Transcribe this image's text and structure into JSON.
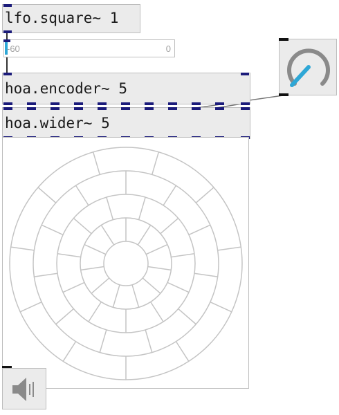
{
  "objects": {
    "lfo": {
      "text": "lfo.square~ 1"
    },
    "encoder": {
      "text": "hoa.encoder~ 5"
    },
    "wider": {
      "text": "hoa.wider~ 5"
    }
  },
  "number_box": {
    "min_label": "-60",
    "max_label": "0",
    "value": 0
  },
  "dial": {
    "icon": "dial-icon",
    "accent": "#2ea7d6"
  },
  "meter": {
    "icon": "hoa-meter-circles"
  },
  "speaker": {
    "icon": "speaker-icon"
  },
  "colors": {
    "port": "#1b1b7a",
    "border": "#bdbdbd",
    "box_bg": "#ebebeb",
    "accent": "#2ea7d6"
  }
}
